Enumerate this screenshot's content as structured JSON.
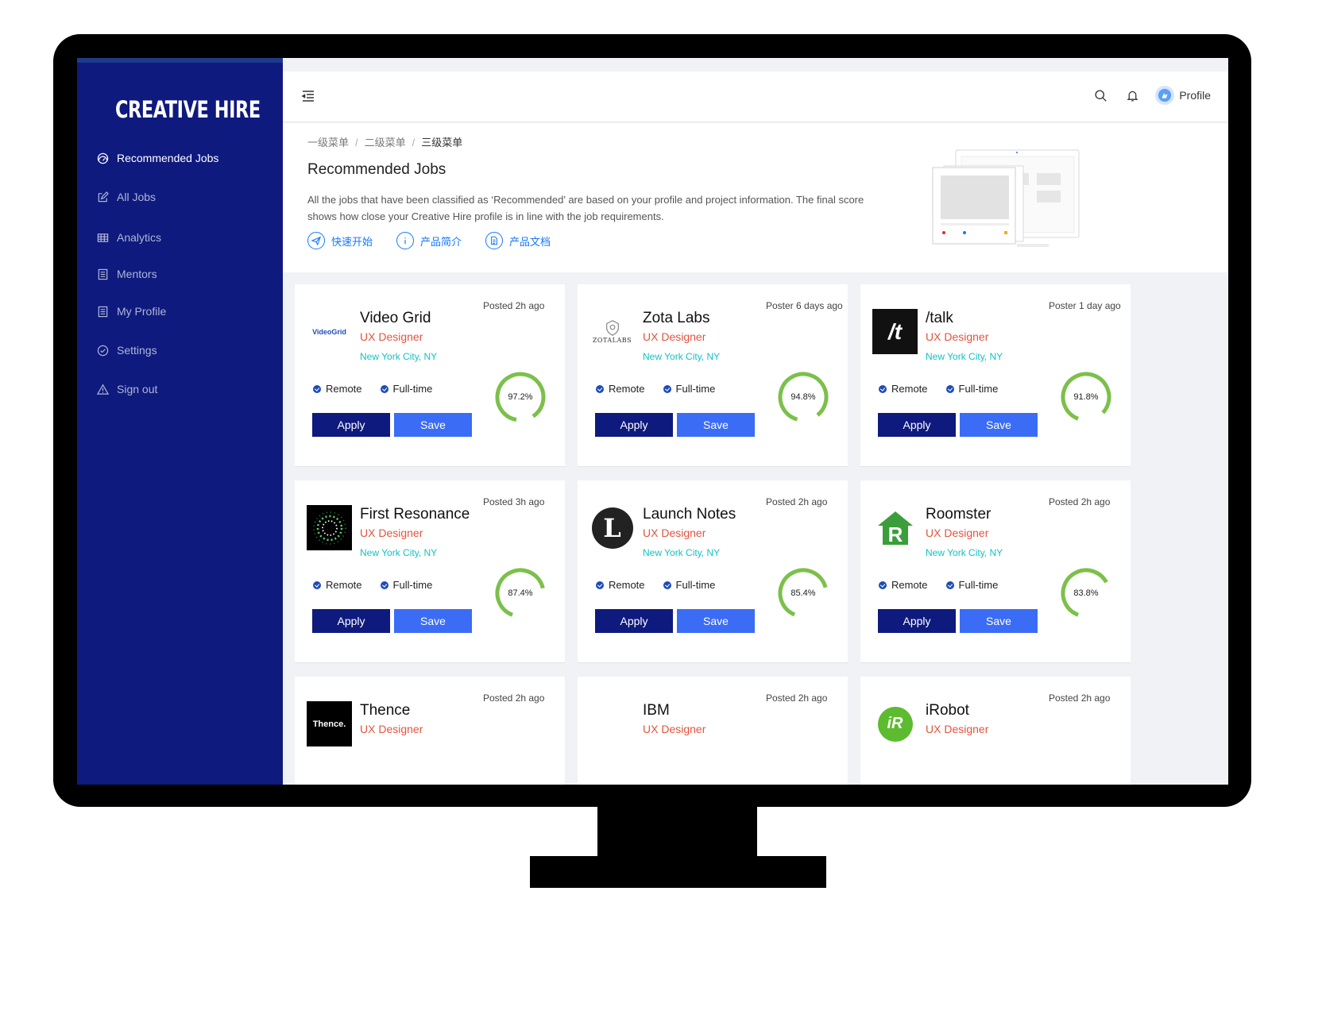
{
  "app": {
    "logo": "CREATIVE HIRE"
  },
  "sidebar": {
    "items": [
      {
        "label": "Recommended Jobs",
        "icon": "dashboard-icon",
        "active": true
      },
      {
        "label": "All Jobs",
        "icon": "edit-icon"
      },
      {
        "label": "Analytics",
        "icon": "table-icon"
      },
      {
        "label": "Mentors",
        "icon": "profile-icon"
      },
      {
        "label": "My Profile",
        "icon": "profile-icon"
      },
      {
        "label": "Settings",
        "icon": "check-circle-icon"
      },
      {
        "label": "Sign out",
        "icon": "warning-icon"
      }
    ]
  },
  "topbar": {
    "profile_label": "Profile"
  },
  "breadcrumb": [
    "一级菜单",
    "二级菜单",
    "三级菜单"
  ],
  "header": {
    "title": "Recommended Jobs",
    "description": "All the jobs that have been classified as ‘Recommended’ are based on your profile and project information. The final score shows how close your Creative Hire profile is in line with the job requirements.",
    "links": [
      {
        "label": "快速开始",
        "icon": "paper-plane-icon"
      },
      {
        "label": "产品简介",
        "icon": "info-icon"
      },
      {
        "label": "产品文档",
        "icon": "document-icon"
      }
    ]
  },
  "accent_colors": {
    "sidebar": "#0f1a7e",
    "apply": "#0f1a7e",
    "save": "#3b6cf6",
    "role": "#e5533d",
    "location": "#13c2c2",
    "score": "#7cc04b"
  },
  "jobs": [
    {
      "company": "Video Grid",
      "role": "UX Designer",
      "location": "New York City, NY",
      "posted": "Posted 2h ago",
      "tags": [
        "Remote",
        "Full-time"
      ],
      "score": 97.2,
      "score_label": "97.2%",
      "apply": "Apply",
      "save": "Save",
      "logo_text": "VideoGrid"
    },
    {
      "company": "Zota Labs",
      "role": "UX Designer",
      "location": "New York City, NY",
      "posted": "Poster 6 days ago",
      "tags": [
        "Remote",
        "Full-time"
      ],
      "score": 94.8,
      "score_label": "94.8%",
      "apply": "Apply",
      "save": "Save",
      "logo_text": "ZOTALABS"
    },
    {
      "company": "/talk",
      "role": "UX Designer",
      "location": "New York City, NY",
      "posted": "Poster 1 day ago",
      "tags": [
        "Remote",
        "Full-time"
      ],
      "score": 91.8,
      "score_label": "91.8%",
      "apply": "Apply",
      "save": "Save",
      "logo_text": "/t"
    },
    {
      "company": "First Resonance",
      "role": "UX Designer",
      "location": "New York City, NY",
      "posted": "Posted 3h ago",
      "tags": [
        "Remote",
        "Full-time"
      ],
      "score": 87.4,
      "score_label": "87.4%",
      "apply": "Apply",
      "save": "Save",
      "logo_text": ""
    },
    {
      "company": "Launch Notes",
      "role": "UX Designer",
      "location": "New York City, NY",
      "posted": "Posted 2h ago",
      "tags": [
        "Remote",
        "Full-time"
      ],
      "score": 85.4,
      "score_label": "85.4%",
      "apply": "Apply",
      "save": "Save",
      "logo_text": "L"
    },
    {
      "company": "Roomster",
      "role": "UX Designer",
      "location": "New York City, NY",
      "posted": "Posted 2h ago",
      "tags": [
        "Remote",
        "Full-time"
      ],
      "score": 83.8,
      "score_label": "83.8%",
      "apply": "Apply",
      "save": "Save",
      "logo_text": "R"
    },
    {
      "company": "Thence",
      "role": "UX Designer",
      "location": "",
      "posted": "Posted 2h ago",
      "tags": [],
      "score": null,
      "score_label": "",
      "apply": "",
      "save": "",
      "logo_text": "Thence."
    },
    {
      "company": "IBM",
      "role": "UX Designer",
      "location": "",
      "posted": "Posted 2h ago",
      "tags": [],
      "score": null,
      "score_label": "",
      "apply": "",
      "save": "",
      "logo_text": ""
    },
    {
      "company": "iRobot",
      "role": "UX Designer",
      "location": "",
      "posted": "Posted 2h ago",
      "tags": [],
      "score": null,
      "score_label": "",
      "apply": "",
      "save": "",
      "logo_text": "iR"
    }
  ]
}
